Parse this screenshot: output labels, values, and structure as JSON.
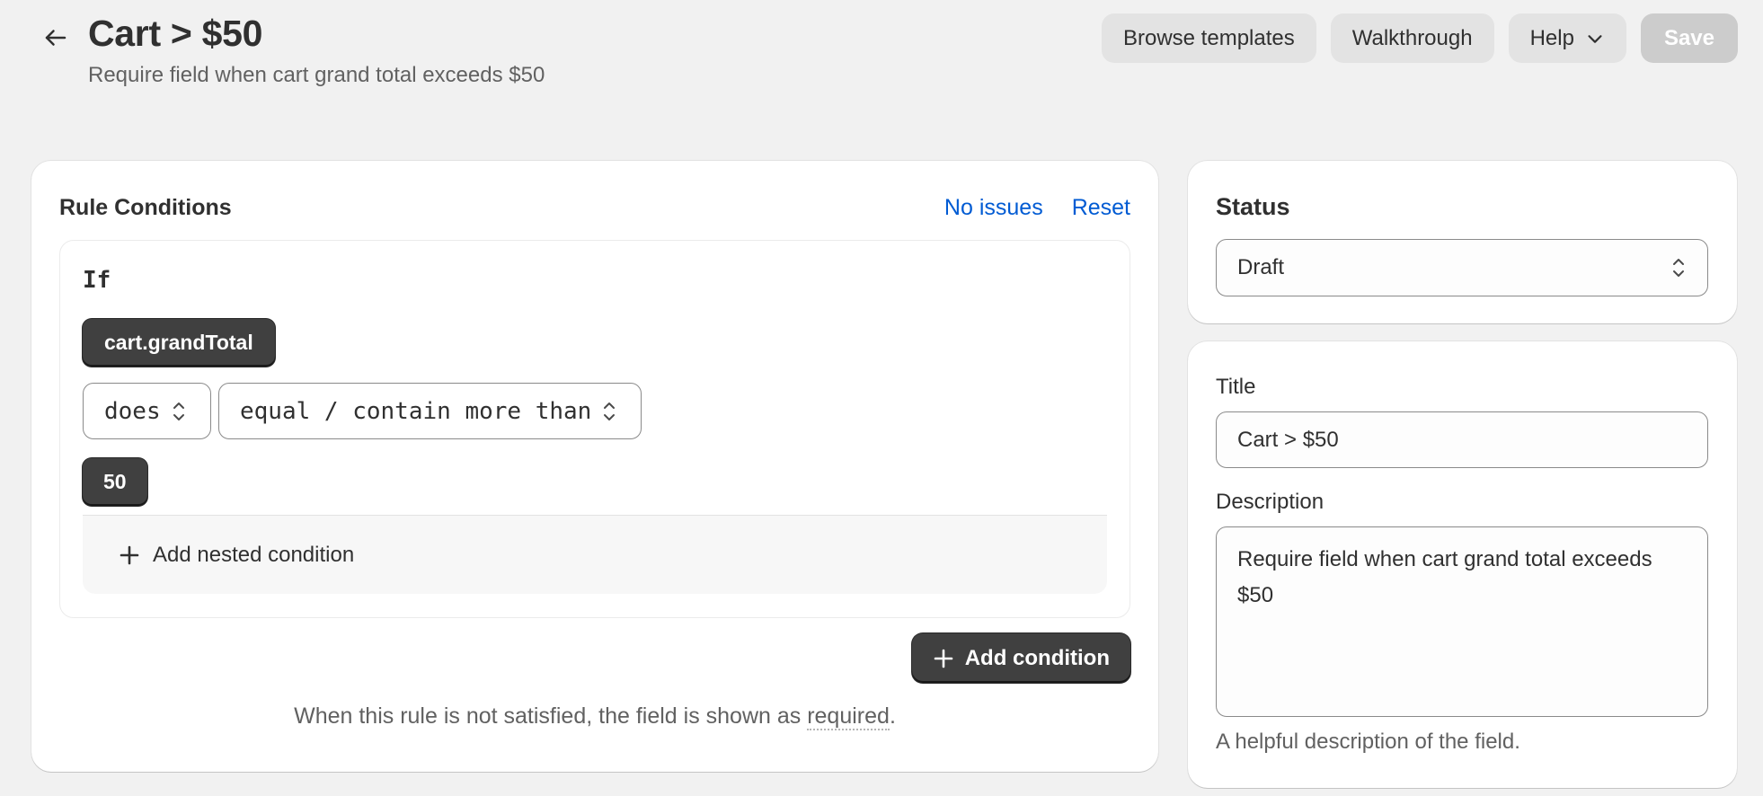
{
  "header": {
    "title": "Cart > $50",
    "subtitle": "Require field when cart grand total exceeds $50",
    "browse_templates": "Browse templates",
    "walkthrough": "Walkthrough",
    "help": "Help",
    "save": "Save"
  },
  "rules": {
    "title": "Rule Conditions",
    "no_issues": "No issues",
    "reset": "Reset",
    "if_label": "If",
    "field_chip": "cart.grandTotal",
    "does_select": "does",
    "operator_select": "equal / contain more than",
    "value_chip": "50",
    "add_nested": "Add nested condition",
    "add_condition": "Add condition",
    "note_prefix": "When this rule is not satisfied, the field is shown as ",
    "note_required": "required",
    "note_suffix": "."
  },
  "status": {
    "label": "Status",
    "value": "Draft"
  },
  "details": {
    "title_label": "Title",
    "title_value": "Cart > $50",
    "description_label": "Description",
    "description_value": "Require field when cart grand total exceeds $50",
    "description_help": "A helpful description of the field."
  },
  "icons": {
    "back": "arrow-left-icon",
    "help_chevron": "chevron-down-icon",
    "select": "select-chevrons-icon",
    "plus": "plus-icon"
  },
  "colors": {
    "background": "#f1f1f1",
    "link": "#005bd3",
    "chip": "#404040",
    "save_disabled": "#cccccc"
  }
}
